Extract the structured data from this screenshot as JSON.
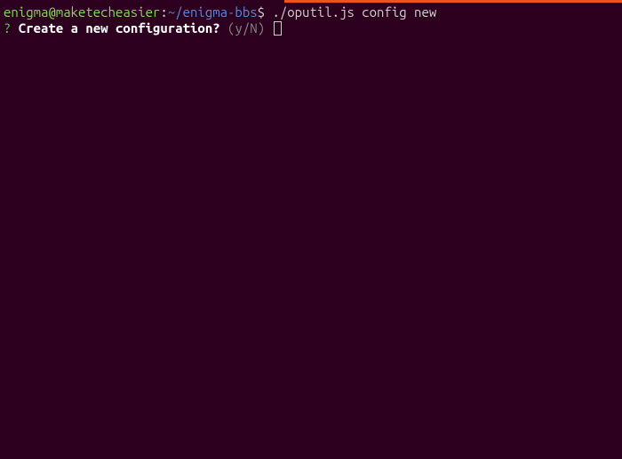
{
  "colors": {
    "background": "#2c001e",
    "accent_bar": "#e95420",
    "user_host": "#87d75f",
    "path": "#5f87d7",
    "default_text": "#d0cfcc",
    "bold_white": "#ffffff",
    "dim": "#888888",
    "question": "#5fd75f"
  },
  "prompt": {
    "user_host": "enigma@maketecheasier",
    "separator": ":",
    "path": "~/enigma-bbs",
    "sigil": "$",
    "command": "./oputil.js config new"
  },
  "interactive_prompt": {
    "marker": "?",
    "question": "Create a new configuration?",
    "hint": "(y/N)"
  }
}
